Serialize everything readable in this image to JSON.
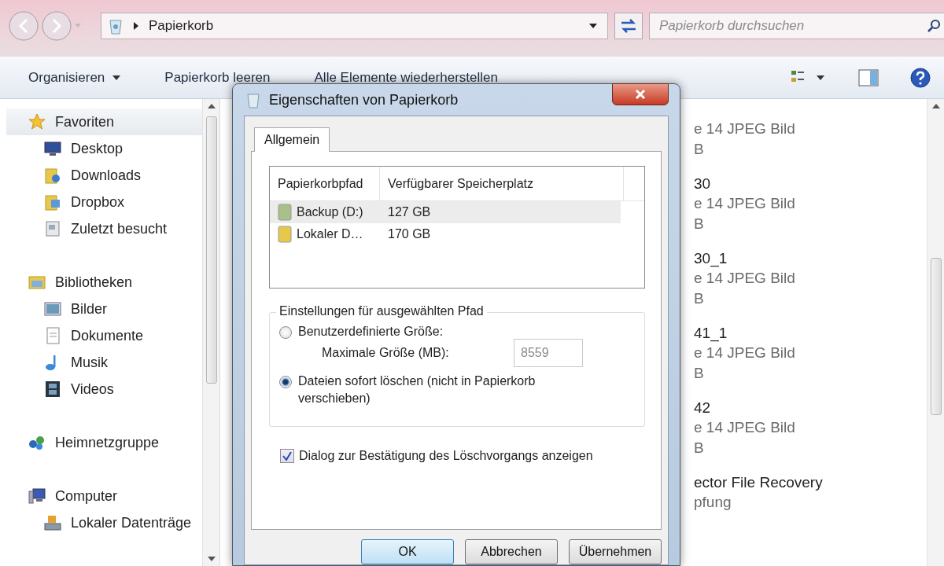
{
  "address_bar": {
    "path": "Papierkorb",
    "search_placeholder": "Papierkorb durchsuchen"
  },
  "toolbar": {
    "items": [
      {
        "label": "Organisieren",
        "dropdown": true
      },
      {
        "label": "Papierkorb leeren",
        "dropdown": false
      },
      {
        "label": "Alle Elemente wiederherstellen",
        "dropdown": false
      }
    ]
  },
  "sidebar": {
    "items": [
      {
        "label": "Favoriten",
        "kind": "star",
        "selected": true,
        "children": [
          {
            "label": "Desktop",
            "kind": "monitor",
            "selected": false
          },
          {
            "label": "Downloads",
            "kind": "folder",
            "selected": false
          },
          {
            "label": "Dropbox",
            "kind": "box",
            "selected": false
          },
          {
            "label": "Zuletzt besucht",
            "kind": "recent",
            "selected": false
          }
        ]
      },
      {
        "label": "Bibliotheken",
        "kind": "library",
        "selected": false,
        "children": [
          {
            "label": "Bilder",
            "kind": "picture",
            "selected": false
          },
          {
            "label": "Dokumente",
            "kind": "document",
            "selected": false
          },
          {
            "label": "Musik",
            "kind": "note",
            "selected": false
          },
          {
            "label": "Videos",
            "kind": "film",
            "selected": false
          }
        ]
      },
      {
        "label": "Heimnetzgruppe",
        "kind": "network",
        "selected": false
      },
      {
        "label": "Computer",
        "kind": "computer",
        "selected": false,
        "children": [
          {
            "label": "Lokaler Datenträge",
            "kind": "drive",
            "selected": false
          }
        ]
      }
    ]
  },
  "files": [
    {
      "type": "e 14 JPEG Bild",
      "size": "B"
    },
    {
      "name": "30",
      "type": "e 14 JPEG Bild",
      "size": "B"
    },
    {
      "name": "30_1",
      "type": "e 14 JPEG Bild",
      "size": "B"
    },
    {
      "name": "41_1",
      "type": "e 14 JPEG Bild",
      "size": "B"
    },
    {
      "name": "42",
      "type": "e 14 JPEG Bild",
      "size": "B"
    },
    {
      "name": "ector File Recovery",
      "type": "pfung"
    }
  ],
  "dialog": {
    "title": "Eigenschaften von Papierkorb",
    "tabs": [
      {
        "label": "Allgemein",
        "selected": true
      }
    ],
    "table": {
      "columns": [
        "Papierkorbpfad",
        "Verfügbarer Speicherplatz"
      ],
      "rows": [
        {
          "path": "Backup (D:)",
          "space": "127 GB",
          "color": "#a8c08a",
          "selected": true
        },
        {
          "path": "Lokaler D…",
          "space": "170 GB",
          "color": "#e8c84a",
          "selected": false
        }
      ]
    },
    "settings": {
      "legend": "Einstellungen für ausgewählten Pfad",
      "options": [
        {
          "label": "Benutzerdefinierte Größe:",
          "selected": false
        },
        {
          "label": "Dateien sofort löschen (nicht in Papierkorb verschieben)",
          "selected": true
        }
      ],
      "max_size": {
        "label": "Maximale Größe (MB):",
        "value": "8559",
        "disabled": true
      }
    },
    "confirm": {
      "label": "Dialog zur Bestätigung des Löschvorgangs anzeigen",
      "checked": true
    },
    "buttons": [
      {
        "label": "OK",
        "default": true
      },
      {
        "label": "Abbrechen",
        "default": false
      },
      {
        "label": "Übernehmen",
        "default": false
      }
    ]
  }
}
